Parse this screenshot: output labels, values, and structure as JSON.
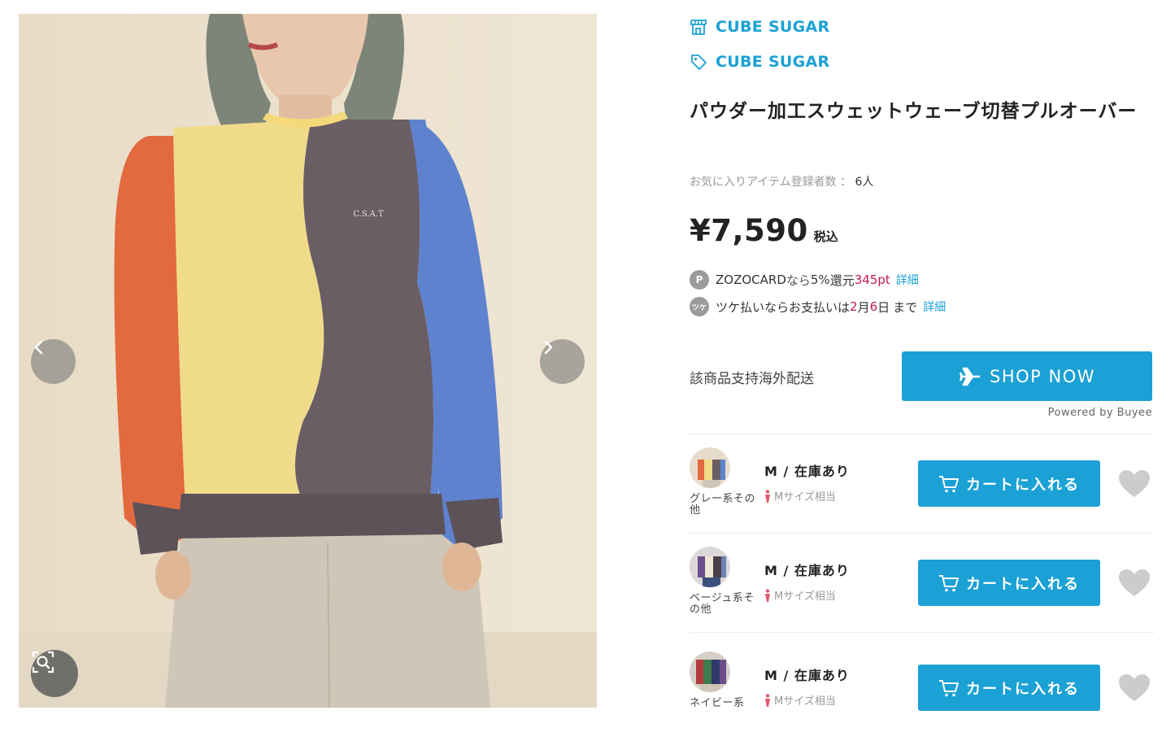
{
  "gallery": {
    "print_text": "C.S.A.T",
    "prev_icon": "chevron-left-icon",
    "next_icon": "chevron-right-icon",
    "zoom_icon": "image-search-icon"
  },
  "shop": {
    "name": "CUBE SUGAR",
    "icon": "shop-icon"
  },
  "brand": {
    "name": "CUBE SUGAR",
    "icon": "tag-icon"
  },
  "product": {
    "title": "パウダー加工スウェットウェーブ切替プルオーバー",
    "favorites_label": "お気に入りアイテム登録者数 ： ",
    "favorites_count": "6人",
    "price": "¥7,590",
    "tax_label": "税込"
  },
  "zozocard": {
    "badge": "P",
    "text_a": "ZOZOCARD",
    "text_b": "なら",
    "text_c": "5%",
    "text_d": "還元",
    "points": "345pt",
    "link": "詳細"
  },
  "tsuke": {
    "badge": "ツケ",
    "text_a": "ツケ払いならお支払いは",
    "month": "2",
    "text_b": "月",
    "day": "6",
    "text_c": "日",
    "text_d": "まで",
    "link": "詳細"
  },
  "shipping": {
    "overseas_label": "該商品支持海外配送",
    "shop_now_label": "SHOP NOW",
    "shop_now_icon": "airplane-icon",
    "powered_by": "Powered by Buyee"
  },
  "variants": [
    {
      "color": "グレー系その他",
      "size_stock": "M / 在庫あり",
      "fit": "Mサイズ相当",
      "cart_label": "カートに入れる"
    },
    {
      "color": "ベージュ系その他",
      "size_stock": "M / 在庫あり",
      "fit": "Mサイズ相当",
      "cart_label": "カートに入れる"
    },
    {
      "color": "ネイビー系",
      "size_stock": "M / 在庫あり",
      "fit": "Mサイズ相当",
      "cart_label": "カートに入れる"
    }
  ],
  "colors": {
    "accent": "#1ba1d5",
    "highlight": "#c2185b",
    "heart": "#cccccc"
  }
}
